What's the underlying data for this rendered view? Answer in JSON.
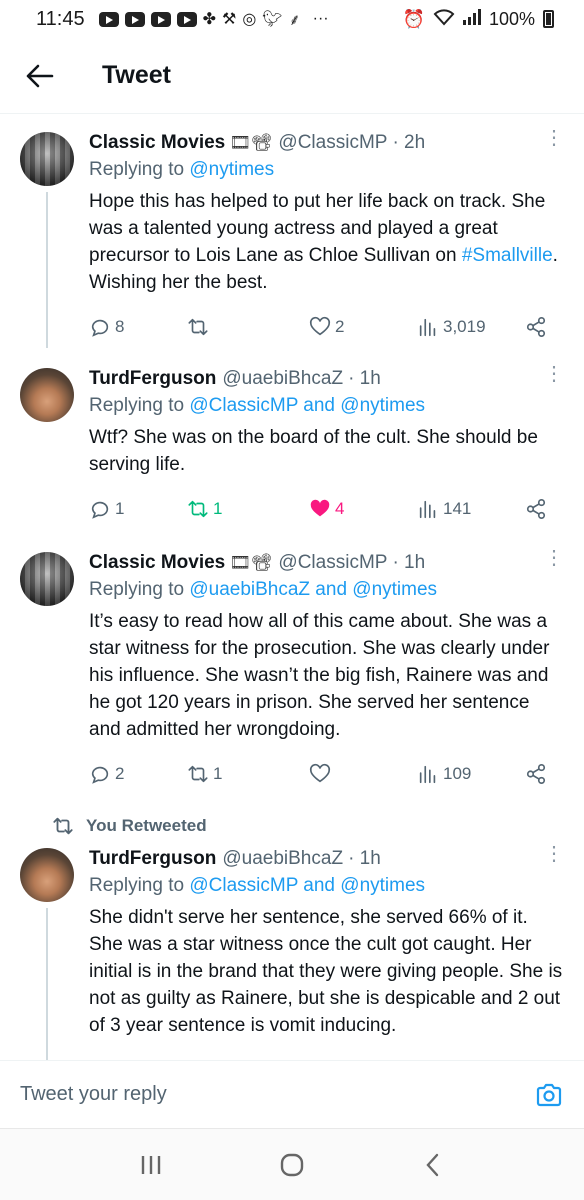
{
  "status_bar": {
    "time": "11:45",
    "more_dots": "···",
    "battery": "100%"
  },
  "header": {
    "title": "Tweet"
  },
  "tweets": [
    {
      "name": "Classic Movies",
      "badge": "🎞📽",
      "handle": "@ClassicMP",
      "time": "· 2h",
      "replying_prefix": "Replying to ",
      "replying_to": "@nytimes",
      "text_before": "Hope this has helped to put her life back on track. She was a talented young actress and played a great precursor to Lois Lane as Chloe Sullivan on ",
      "hashtag": "#Smallville",
      "text_after": ". Wishing her the best.",
      "replies": "8",
      "retweets": "",
      "likes": "2",
      "views": "3,019"
    },
    {
      "name": "TurdFerguson",
      "handle": "@uaebiBhcaZ",
      "time": "· 1h",
      "replying_prefix": "Replying to ",
      "replying_to": "@ClassicMP and @nytimes",
      "text": "Wtf? She was on the board of the cult. She should be serving life.",
      "replies": "1",
      "retweets": "1",
      "likes": "4",
      "views": "141"
    },
    {
      "name": "Classic Movies",
      "badge": "🎞📽",
      "handle": "@ClassicMP",
      "time": "· 1h",
      "replying_prefix": "Replying to ",
      "replying_to": "@uaebiBhcaZ and @nytimes",
      "text": "It’s easy to read how all of this came about. She was a star witness for the prosecution. She was clearly under his influence. She wasn’t the big fish, Rainere was and he got 120 years in prison. She served her sentence and admitted her wrongdoing.",
      "replies": "2",
      "retweets": "1",
      "likes": "",
      "views": "109"
    },
    {
      "retweet_label": "You Retweeted",
      "name": "TurdFerguson",
      "handle": "@uaebiBhcaZ",
      "time": "· 1h",
      "replying_prefix": "Replying to ",
      "replying_to": "@ClassicMP and @nytimes",
      "text": "She didn't serve her sentence, she served 66% of it. She was a star witness once the cult got caught. Her initial is in the brand that they were giving people. She is not as guilty as Rainere, but she is despicable and 2 out of 3 year sentence is vomit inducing."
    }
  ],
  "composer": {
    "placeholder": "Tweet your reply"
  },
  "colors": {
    "accent": "#1d9bf0",
    "retweet": "#00ba7c",
    "like": "#f91880",
    "secondary_text": "#536471"
  }
}
